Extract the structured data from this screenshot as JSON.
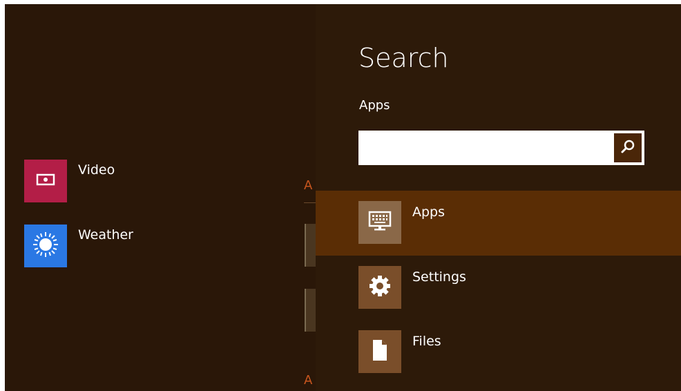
{
  "start_screen": {
    "apps": [
      {
        "label": "Video",
        "icon": "video-icon",
        "color": "#b31e47"
      },
      {
        "label": "Weather",
        "icon": "sun-icon",
        "color": "#2a78e4"
      }
    ],
    "group_letters": [
      "A",
      "A"
    ]
  },
  "search_charm": {
    "title": "Search",
    "scope": "Apps",
    "search": {
      "value": "",
      "placeholder": ""
    },
    "scopes": [
      {
        "label": "Apps",
        "icon": "keyboard-icon",
        "selected": true
      },
      {
        "label": "Settings",
        "icon": "gear-icon",
        "selected": false
      },
      {
        "label": "Files",
        "icon": "file-icon",
        "selected": false
      }
    ]
  },
  "colors": {
    "background": "#2a1708",
    "charm_background": "#2d1a09",
    "selected": "#5a2d05",
    "accent": "#c8561e"
  }
}
